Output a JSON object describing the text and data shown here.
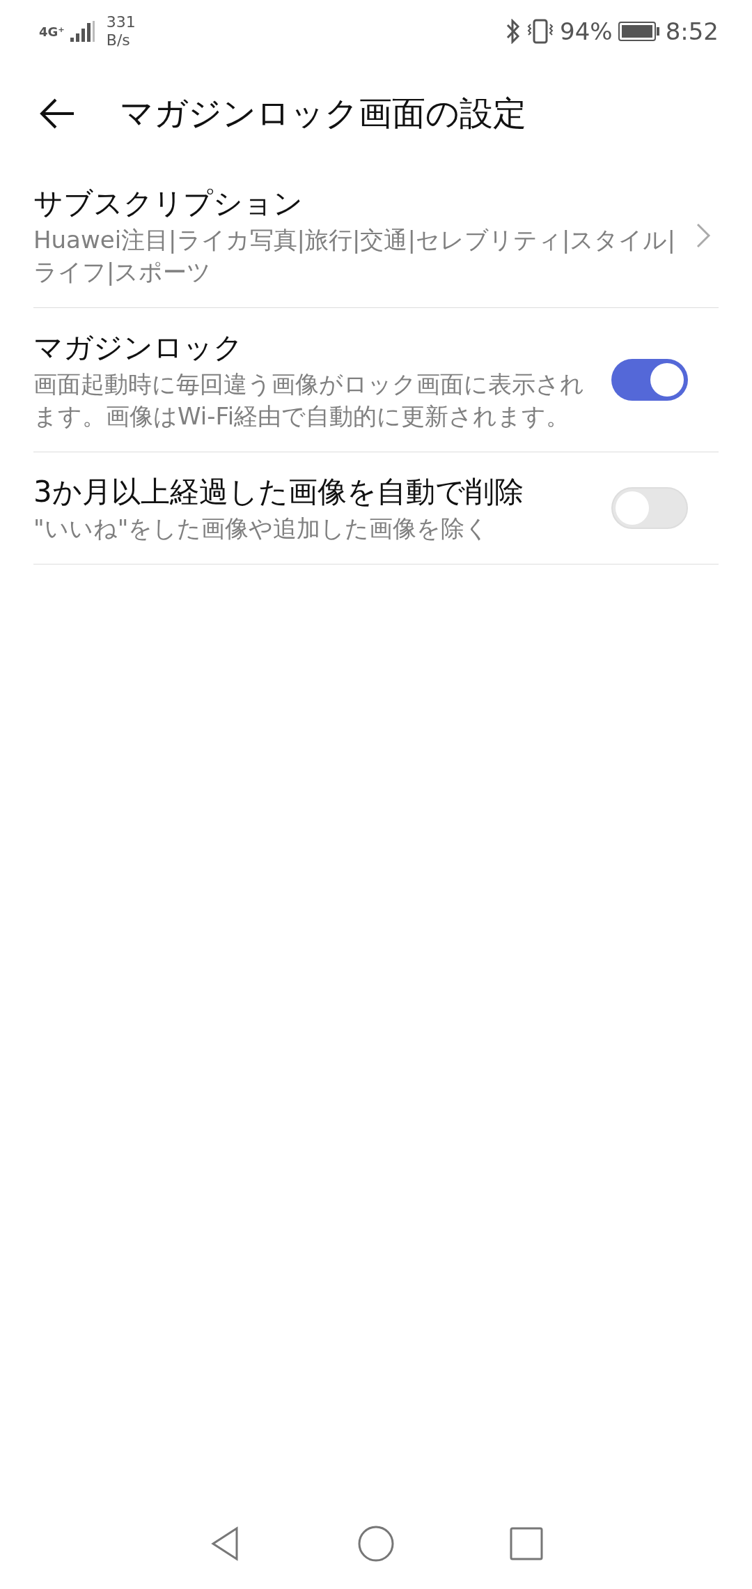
{
  "status_bar": {
    "network": "4G⁺",
    "speed_value": "331",
    "speed_unit": "B/s",
    "battery": "94%",
    "time": "8:52"
  },
  "header": {
    "title": "マガジンロック画面の設定"
  },
  "settings": [
    {
      "kind": "link",
      "title": "サブスクリプション",
      "subtitle": "Huawei注目|ライカ写真|旅行|交通|セレブリティ|スタイル|ライフ|スポーツ"
    },
    {
      "kind": "toggle",
      "title": "マガジンロック",
      "subtitle": "画面起動時に毎回違う画像がロック画面に表示されます。画像はWi-Fi経由で自動的に更新されます。",
      "on": true
    },
    {
      "kind": "toggle",
      "title": "3か月以上経過した画像を自動で削除",
      "subtitle": "\"いいね\"をした画像や追加した画像を除く",
      "on": false
    }
  ]
}
